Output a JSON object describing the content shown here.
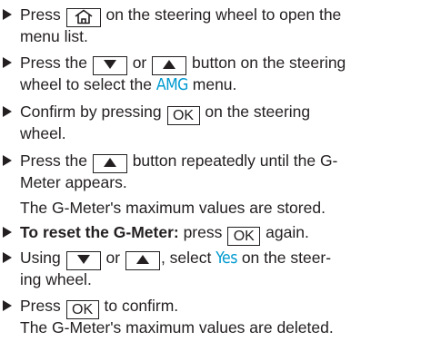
{
  "colors": {
    "text": "#231f20",
    "display_text": "#009ad0"
  },
  "icons": {
    "bullet": "triangle-right-icon",
    "home": "home-icon",
    "down": "down-arrow-icon",
    "up": "up-arrow-icon"
  },
  "steps": {
    "s1": {
      "a": "Press",
      "b": "on the steering wheel to open the",
      "c": "menu list."
    },
    "s2": {
      "a": "Press the",
      "b": "or",
      "c": "button on the steering",
      "d": "wheel to select the",
      "menu": "AMG",
      "e": "menu."
    },
    "s3": {
      "a": "Confirm by pressing",
      "ok": "OK",
      "b": "on the steering",
      "c": "wheel."
    },
    "s4": {
      "a": "Press the",
      "b": "button repeatedly until the G-",
      "c": "Meter appears."
    },
    "s4_result": "The G-Meter's maximum values are stored.",
    "s5": {
      "heading": "To reset the G-Meter:",
      "a": "press",
      "ok": "OK",
      "b": "again."
    },
    "s6": {
      "a": "Using",
      "b": "or",
      "c": ", select",
      "option": "Yes",
      "d": "on the steer-",
      "e": "ing wheel."
    },
    "s7": {
      "a": "Press",
      "ok": "OK",
      "b": "to confirm.",
      "result": "The G-Meter's maximum values are deleted."
    }
  }
}
